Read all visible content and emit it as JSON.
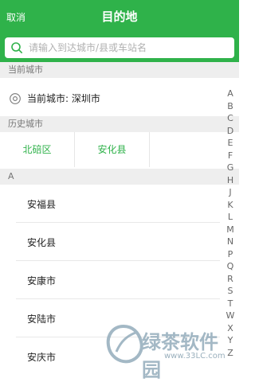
{
  "header": {
    "cancel_label": "取消",
    "title": "目的地"
  },
  "search": {
    "placeholder": "请输入到达城市/县或车站名",
    "value": "",
    "icon": "search-icon"
  },
  "current_city": {
    "section_label": "当前城市",
    "text": "当前城市: 深圳市",
    "icon": "locate-icon"
  },
  "history": {
    "section_label": "历史城市",
    "items": [
      "北碚区",
      "安化县"
    ]
  },
  "list": {
    "section_label": "A",
    "items": [
      "安福县",
      "安化县",
      "安康市",
      "安陆市",
      "安庆市"
    ]
  },
  "index": {
    "letters": [
      "A",
      "B",
      "C",
      "D",
      "E",
      "F",
      "G",
      "H",
      "J",
      "K",
      "L",
      "M",
      "N",
      "P",
      "Q",
      "R",
      "S",
      "T",
      "W",
      "X",
      "Y",
      "Z"
    ]
  },
  "watermark": {
    "brand": "绿茶软件园",
    "url": "www.33LC.com"
  },
  "colors": {
    "accent": "#2fb24a",
    "section_bg": "#eeeeee"
  }
}
